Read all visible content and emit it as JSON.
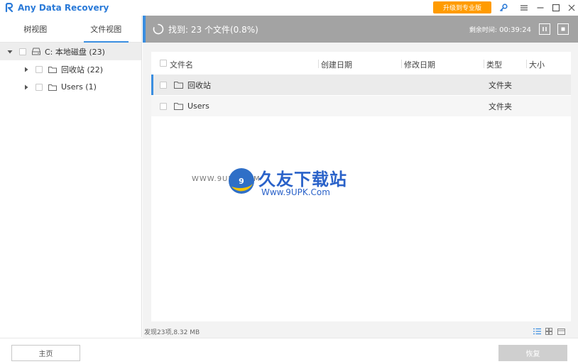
{
  "app": {
    "title": "Any Data Recovery",
    "upgrade_label": "升级到专业版"
  },
  "colors": {
    "accent": "#3b8ee0",
    "upgrade": "#ff9b00",
    "header_bg": "#a3a3a3"
  },
  "left": {
    "tabs": [
      "树视图",
      "文件视图"
    ],
    "tree": {
      "root": {
        "label": "C: 本地磁盘 (23)",
        "icon": "drive-icon"
      },
      "children": [
        {
          "label": "回收站 (22)",
          "icon": "folder-icon"
        },
        {
          "label": "Users (1)",
          "icon": "folder-icon"
        }
      ]
    }
  },
  "scan": {
    "found_text": "找到: 23 个文件(0.8%)",
    "remaining_label": "剩余时间:",
    "remaining_time": "00:39:24"
  },
  "table": {
    "columns": [
      "文件名",
      "创建日期",
      "修改日期",
      "类型",
      "大小"
    ],
    "rows": [
      {
        "name": "回收站",
        "created": "",
        "modified": "",
        "type": "文件夹",
        "size": ""
      },
      {
        "name": "Users",
        "created": "",
        "modified": "",
        "type": "文件夹",
        "size": ""
      }
    ]
  },
  "watermark": {
    "cn": "久友下载站",
    "url_left": "WWW.9UPK.COM",
    "url": "Www.9UPK.Com"
  },
  "status": {
    "text": "发现23项,8.32 MB"
  },
  "footer": {
    "home_label": "主页",
    "recover_label": "恢复"
  }
}
